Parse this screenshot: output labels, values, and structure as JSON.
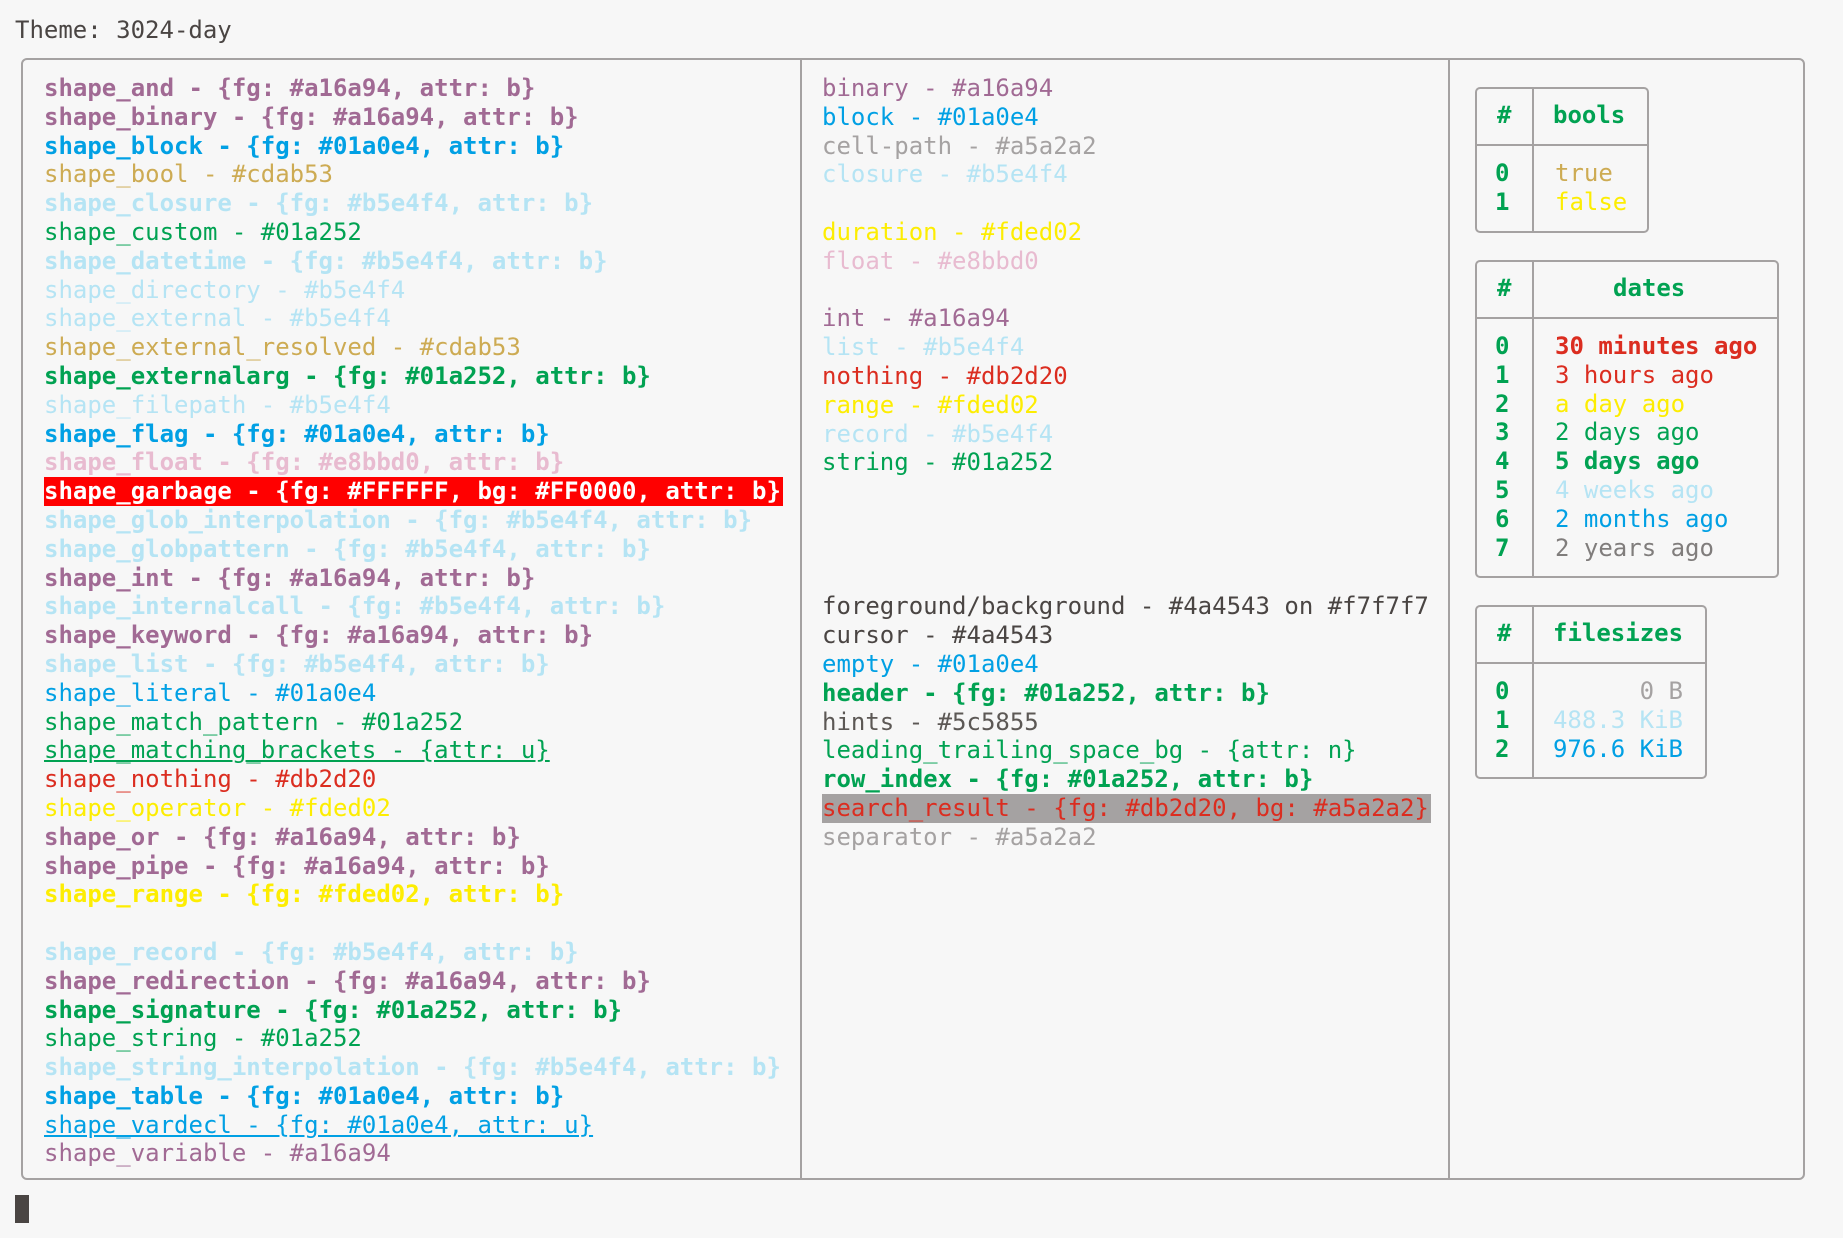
{
  "title": "Theme: 3024-day",
  "column1": [
    {
      "text": "shape_and - {fg: #a16a94, attr: b}",
      "color": "#a16a94",
      "bold": true
    },
    {
      "text": "shape_binary - {fg: #a16a94, attr: b}",
      "color": "#a16a94",
      "bold": true
    },
    {
      "text": "shape_block - {fg: #01a0e4, attr: b}",
      "color": "#01a0e4",
      "bold": true
    },
    {
      "text": "shape_bool - #cdab53",
      "color": "#cdab53"
    },
    {
      "text": "shape_closure - {fg: #b5e4f4, attr: b}",
      "color": "#b5e4f4",
      "bold": true
    },
    {
      "text": "shape_custom - #01a252",
      "color": "#01a252"
    },
    {
      "text": "shape_datetime - {fg: #b5e4f4, attr: b}",
      "color": "#b5e4f4",
      "bold": true
    },
    {
      "text": "shape_directory - #b5e4f4",
      "color": "#b5e4f4"
    },
    {
      "text": "shape_external - #b5e4f4",
      "color": "#b5e4f4"
    },
    {
      "text": "shape_external_resolved - #cdab53",
      "color": "#cdab53"
    },
    {
      "text": "shape_externalarg - {fg: #01a252, attr: b}",
      "color": "#01a252",
      "bold": true
    },
    {
      "text": "shape_filepath - #b5e4f4",
      "color": "#b5e4f4"
    },
    {
      "text": "shape_flag - {fg: #01a0e4, attr: b}",
      "color": "#01a0e4",
      "bold": true
    },
    {
      "text": "shape_float - {fg: #e8bbd0, attr: b}",
      "color": "#e8bbd0",
      "bold": true
    },
    {
      "text": "shape_garbage - {fg: #FFFFFF, bg: #FF0000, attr: b}",
      "color": "#FFFFFF",
      "bg": "#FF0000",
      "bold": true
    },
    {
      "text": "shape_glob_interpolation - {fg: #b5e4f4, attr: b}",
      "color": "#b5e4f4",
      "bold": true
    },
    {
      "text": "shape_globpattern - {fg: #b5e4f4, attr: b}",
      "color": "#b5e4f4",
      "bold": true
    },
    {
      "text": "shape_int - {fg: #a16a94, attr: b}",
      "color": "#a16a94",
      "bold": true
    },
    {
      "text": "shape_internalcall - {fg: #b5e4f4, attr: b}",
      "color": "#b5e4f4",
      "bold": true
    },
    {
      "text": "shape_keyword - {fg: #a16a94, attr: b}",
      "color": "#a16a94",
      "bold": true
    },
    {
      "text": "shape_list - {fg: #b5e4f4, attr: b}",
      "color": "#b5e4f4",
      "bold": true
    },
    {
      "text": "shape_literal - #01a0e4",
      "color": "#01a0e4"
    },
    {
      "text": "shape_match_pattern - #01a252",
      "color": "#01a252"
    },
    {
      "text": "shape_matching_brackets - {attr: u}",
      "color": "#01a252",
      "underline": true
    },
    {
      "text": "shape_nothing - #db2d20",
      "color": "#db2d20"
    },
    {
      "text": "shape_operator - #fded02",
      "color": "#fded02"
    },
    {
      "text": "shape_or - {fg: #a16a94, attr: b}",
      "color": "#a16a94",
      "bold": true
    },
    {
      "text": "shape_pipe - {fg: #a16a94, attr: b}",
      "color": "#a16a94",
      "bold": true
    },
    {
      "text": "shape_range - {fg: #fded02, attr: b}",
      "color": "#fded02",
      "bold": true
    },
    {
      "text": "",
      "color": "#4a4543"
    },
    {
      "text": "shape_record - {fg: #b5e4f4, attr: b}",
      "color": "#b5e4f4",
      "bold": true
    },
    {
      "text": "shape_redirection - {fg: #a16a94, attr: b}",
      "color": "#a16a94",
      "bold": true
    },
    {
      "text": "shape_signature - {fg: #01a252, attr: b}",
      "color": "#01a252",
      "bold": true
    },
    {
      "text": "shape_string - #01a252",
      "color": "#01a252"
    },
    {
      "text": "shape_string_interpolation - {fg: #b5e4f4, attr: b}",
      "color": "#b5e4f4",
      "bold": true
    },
    {
      "text": "shape_table - {fg: #01a0e4, attr: b}",
      "color": "#01a0e4",
      "bold": true
    },
    {
      "text": "shape_vardecl - {fg: #01a0e4, attr: u}",
      "color": "#01a0e4",
      "underline": true
    },
    {
      "text": "shape_variable - #a16a94",
      "color": "#a16a94"
    }
  ],
  "column2": [
    {
      "text": "binary - #a16a94",
      "color": "#a16a94"
    },
    {
      "text": "block - #01a0e4",
      "color": "#01a0e4"
    },
    {
      "text": "cell-path - #a5a2a2",
      "color": "#a5a2a2"
    },
    {
      "text": "closure - #b5e4f4",
      "color": "#b5e4f4"
    },
    {
      "text": "",
      "color": "#4a4543"
    },
    {
      "text": "duration - #fded02",
      "color": "#fded02"
    },
    {
      "text": "float - #e8bbd0",
      "color": "#e8bbd0"
    },
    {
      "text": "",
      "color": "#4a4543"
    },
    {
      "text": "int - #a16a94",
      "color": "#a16a94"
    },
    {
      "text": "list - #b5e4f4",
      "color": "#b5e4f4"
    },
    {
      "text": "nothing - #db2d20",
      "color": "#db2d20"
    },
    {
      "text": "range - #fded02",
      "color": "#fded02"
    },
    {
      "text": "record - #b5e4f4",
      "color": "#b5e4f4"
    },
    {
      "text": "string - #01a252",
      "color": "#01a252"
    },
    {
      "text": "",
      "color": "#4a4543"
    },
    {
      "text": "",
      "color": "#4a4543"
    },
    {
      "text": "",
      "color": "#4a4543"
    },
    {
      "text": "",
      "color": "#4a4543"
    },
    {
      "text": "foreground/background - #4a4543 on #f7f7f7",
      "color": "#4a4543"
    },
    {
      "text": "cursor - #4a4543",
      "color": "#4a4543"
    },
    {
      "text": "empty - #01a0e4",
      "color": "#01a0e4"
    },
    {
      "text": "header - {fg: #01a252, attr: b}",
      "color": "#01a252",
      "bold": true
    },
    {
      "text": "hints - #5c5855",
      "color": "#5c5855"
    },
    {
      "text": "leading_trailing_space_bg - {attr: n}",
      "color": "#01a252"
    },
    {
      "text": "row_index - {fg: #01a252, attr: b}",
      "color": "#01a252",
      "bold": true
    },
    {
      "text": "search_result - {fg: #db2d20, bg: #a5a2a2}",
      "color": "#db2d20",
      "bg": "#a5a2a2"
    },
    {
      "text": "separator - #a5a2a2",
      "color": "#a5a2a2"
    }
  ],
  "bools": {
    "index_header": "#",
    "header": "bools",
    "rows": [
      {
        "index": "0",
        "value": "true",
        "color": "#cdab53"
      },
      {
        "index": "1",
        "value": "false",
        "color": "#fded02"
      }
    ]
  },
  "dates": {
    "index_header": "#",
    "header": "dates",
    "rows": [
      {
        "index": "0",
        "value": "30 minutes ago",
        "color": "#db2d20",
        "bold": true
      },
      {
        "index": "1",
        "value": "3 hours ago",
        "color": "#db2d20"
      },
      {
        "index": "2",
        "value": "a day ago",
        "color": "#fded02"
      },
      {
        "index": "3",
        "value": "2 days ago",
        "color": "#01a252"
      },
      {
        "index": "4",
        "value": "5 days ago",
        "color": "#01a252",
        "bold": true
      },
      {
        "index": "5",
        "value": "4 weeks ago",
        "color": "#b5e4f4"
      },
      {
        "index": "6",
        "value": "2 months ago",
        "color": "#01a0e4"
      },
      {
        "index": "7",
        "value": "2 years ago",
        "color": "#807d7c"
      }
    ]
  },
  "filesizes": {
    "index_header": "#",
    "header": "filesizes",
    "rows": [
      {
        "index": "0",
        "value": "0 B",
        "color": "#a5a2a2"
      },
      {
        "index": "1",
        "value": "488.3 KiB",
        "color": "#b5e4f4"
      },
      {
        "index": "2",
        "value": "976.6 KiB",
        "color": "#01a0e4"
      }
    ]
  }
}
